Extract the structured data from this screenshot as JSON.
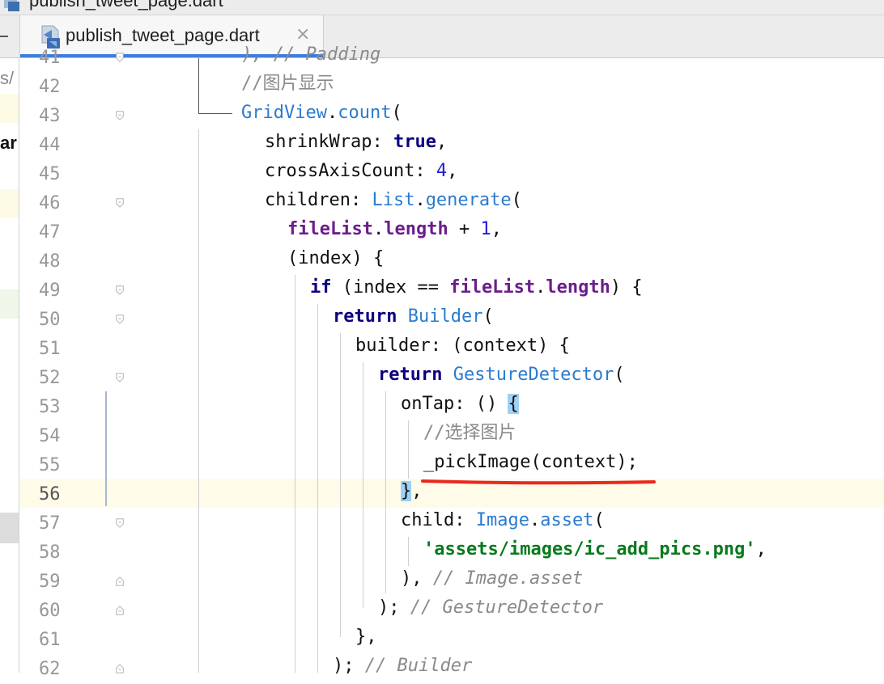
{
  "window": {
    "title": "publish_tweet_page.dart"
  },
  "tab": {
    "label": "publish_tweet_page.dart",
    "close_glyph": "×",
    "icon": "dart-file-icon"
  },
  "side_fragments": {
    "path": "s/",
    "word": "ar"
  },
  "editor": {
    "line_numbers": [
      "41",
      "42",
      "43",
      "44",
      "45",
      "46",
      "47",
      "48",
      "49",
      "50",
      "51",
      "52",
      "53",
      "54",
      "55",
      "56",
      "57",
      "58",
      "59",
      "60",
      "61",
      "62"
    ],
    "current_line": "56",
    "lines": {
      "l41": "), // Padding",
      "l42": "//图片显示",
      "l43_type": "GridView",
      "l43_method": "count",
      "l43_rest": "(",
      "l44_prop": "shrinkWrap: ",
      "l44_kw": "true",
      "l44_rest": ",",
      "l45_prop": "crossAxisCount: ",
      "l45_num": "4",
      "l45_rest": ",",
      "l46_prop": "children: ",
      "l46_type": "List",
      "l46_method": "generate",
      "l46_rest": "(",
      "l47_field": "fileList",
      "l47_dot": ".",
      "l47_field2": "length",
      "l47_op": " + ",
      "l47_num": "1",
      "l47_rest": ",",
      "l48": "(index) {",
      "l49_kw": "if",
      "l49_mid": " (index == ",
      "l49_field": "fileList",
      "l49_dot": ".",
      "l49_field2": "length",
      "l49_rest": ") {",
      "l50_kw": "return",
      "l50_type": "Builder",
      "l50_rest": "(",
      "l51": "builder: (context) {",
      "l52_kw": "return",
      "l52_type": "GestureDetector",
      "l52_rest": "(",
      "l53_pre": "onTap: () ",
      "l53_brace": "{",
      "l54": "//选择图片",
      "l55": "_pickImage(context);",
      "l56_brace": "}",
      "l56_rest": ",",
      "l57_prop": "child: ",
      "l57_type": "Image",
      "l57_method": "asset",
      "l57_rest": "(",
      "l58_str": "'assets/images/ic_add_pics.png'",
      "l58_rest": ",",
      "l59_pre": "), ",
      "l59_comment": "// Image.asset",
      "l60_pre": "); ",
      "l60_comment": "// GestureDetector",
      "l61": "},",
      "l62_pre": "); ",
      "l62_comment": "// Builder"
    }
  },
  "colors": {
    "keyword": "#0b0080",
    "type": "#2a7bcf",
    "field": "#6b1e8b",
    "number": "#2020d6",
    "string": "#087a1c",
    "comment": "#8a8a8a",
    "annotation_underline": "#e8291c",
    "current_line_bg": "#fefbe9",
    "brace_match_bg": "#9fd0f5"
  }
}
